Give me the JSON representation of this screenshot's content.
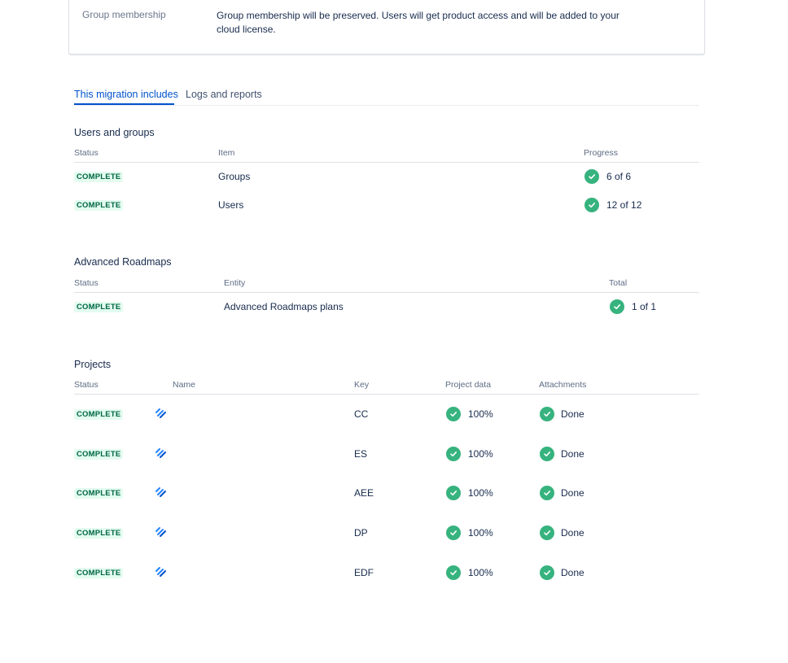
{
  "group_membership": {
    "label": "Group membership",
    "description": "Group membership will be preserved. Users will get product access and will be added to your cloud license."
  },
  "tabs": [
    {
      "label": "This migration includes",
      "active": true
    },
    {
      "label": "Logs and reports",
      "active": false
    }
  ],
  "users_groups": {
    "title": "Users and groups",
    "headers": {
      "status": "Status",
      "item": "Item",
      "progress": "Progress"
    },
    "rows": [
      {
        "status": "COMPLETE",
        "item": "Groups",
        "progress": "6 of 6"
      },
      {
        "status": "COMPLETE",
        "item": "Users",
        "progress": "12 of 12"
      }
    ]
  },
  "roadmaps": {
    "title": "Advanced Roadmaps",
    "headers": {
      "status": "Status",
      "entity": "Entity",
      "total": "Total"
    },
    "rows": [
      {
        "status": "COMPLETE",
        "entity": "Advanced Roadmaps plans",
        "total": "1 of 1"
      }
    ]
  },
  "projects": {
    "title": "Projects",
    "headers": {
      "status": "Status",
      "name": "Name",
      "key": "Key",
      "project_data": "Project data",
      "attachments": "Attachments"
    },
    "rows": [
      {
        "status": "COMPLETE",
        "name": "",
        "key": "CC",
        "project_data": "100%",
        "attachments": "Done"
      },
      {
        "status": "COMPLETE",
        "name": "",
        "key": "ES",
        "project_data": "100%",
        "attachments": "Done"
      },
      {
        "status": "COMPLETE",
        "name": "",
        "key": "AEE",
        "project_data": "100%",
        "attachments": "Done"
      },
      {
        "status": "COMPLETE",
        "name": "",
        "key": "DP",
        "project_data": "100%",
        "attachments": "Done"
      },
      {
        "status": "COMPLETE",
        "name": "",
        "key": "EDF",
        "project_data": "100%",
        "attachments": "Done"
      }
    ]
  },
  "icons": {
    "check": "check-circle-icon",
    "project": "jira-software-project-icon"
  },
  "colors": {
    "success": "#36b37e",
    "lozenge_bg": "#e3fcef",
    "lozenge_text": "#006644",
    "link": "#0052cc"
  }
}
